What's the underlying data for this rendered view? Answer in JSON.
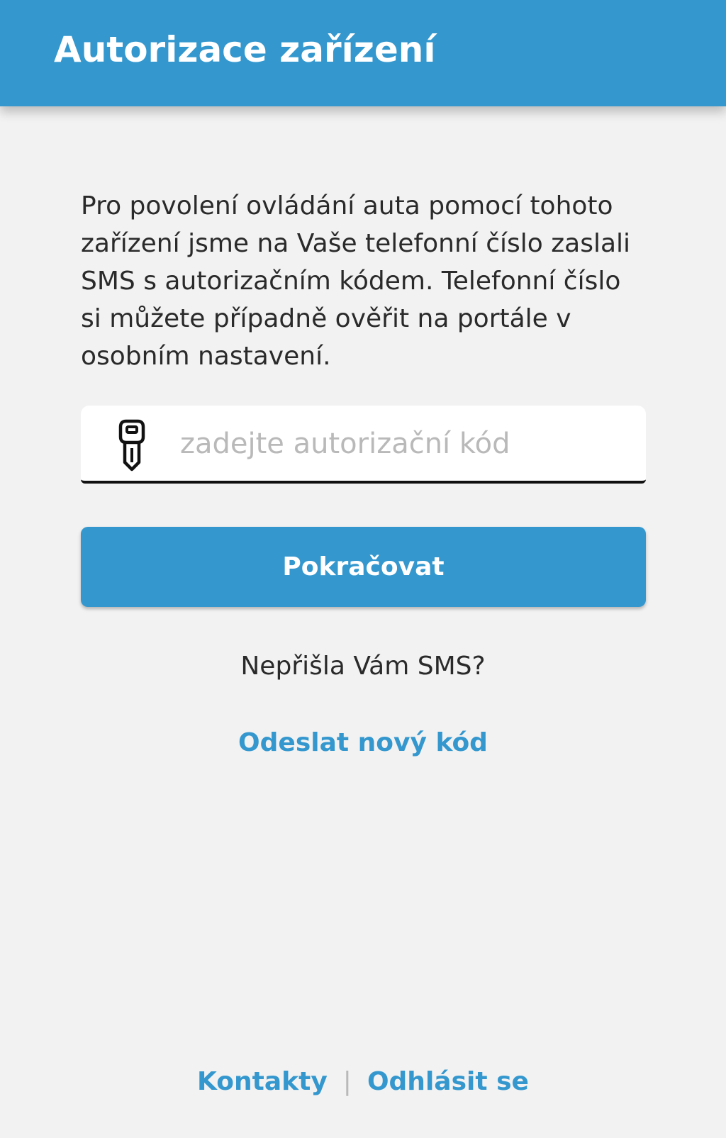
{
  "header": {
    "title": "Autorizace zařízení"
  },
  "main": {
    "description": "Pro povolení ovládání auta pomocí tohoto zařízení jsme na Vaše telefonní číslo zaslali SMS s autorizačním kódem. Telefonní číslo si můžete případně ověřit na portále v osobním nastavení.",
    "code_input": {
      "placeholder": "zadejte autorizační kód",
      "value": "",
      "icon": "key-icon"
    },
    "continue_label": "Pokračovat",
    "no_sms_text": "Nepřišla Vám SMS?",
    "resend_label": "Odeslat nový kód"
  },
  "footer": {
    "contacts_label": "Kontakty",
    "separator": "|",
    "logout_label": "Odhlásit se"
  },
  "colors": {
    "brand_blue": "#3498cf",
    "background": "#f2f2f2",
    "text": "#2a2a2a",
    "placeholder": "#b9b9b9"
  }
}
